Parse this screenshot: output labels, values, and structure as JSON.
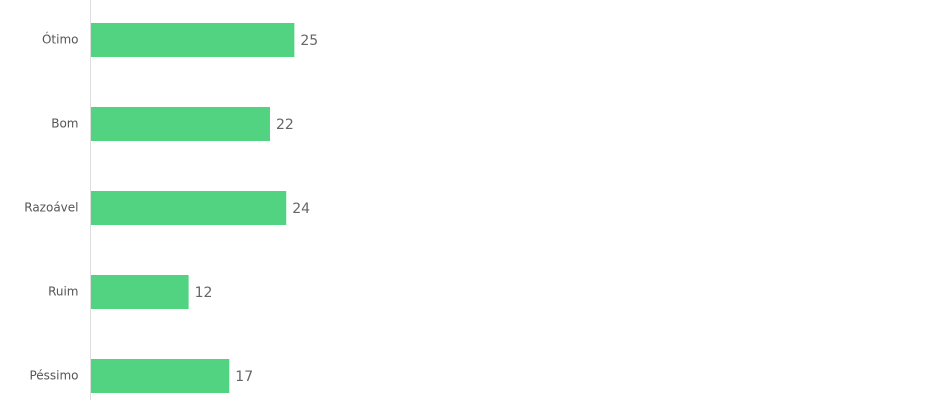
{
  "chart_data": {
    "type": "bar",
    "orientation": "horizontal",
    "categories": [
      "Ótimo",
      "Bom",
      "Razoável",
      "Ruim",
      "Péssimo"
    ],
    "values": [
      25,
      22,
      24,
      12,
      17
    ],
    "title": "",
    "xlabel": "",
    "ylabel": "",
    "xlim": [
      0,
      100
    ],
    "grid": false,
    "legend": "none",
    "bar_color": "#52d381",
    "axis_color": "#dddddd"
  }
}
